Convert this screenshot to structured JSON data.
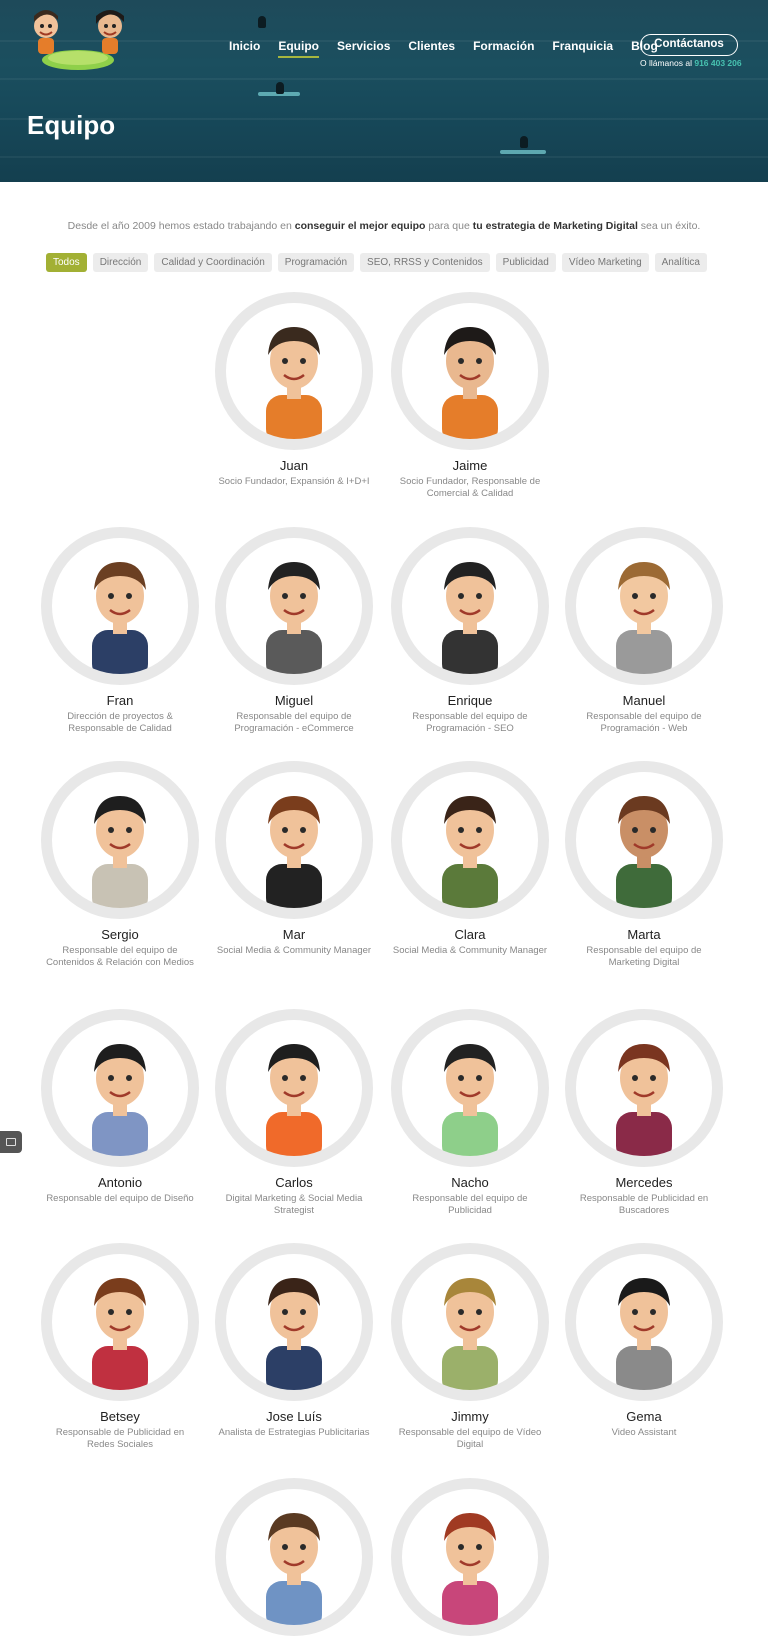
{
  "nav": {
    "items": [
      {
        "label": "Inicio",
        "active": false
      },
      {
        "label": "Equipo",
        "active": true
      },
      {
        "label": "Servicios",
        "active": false
      },
      {
        "label": "Clientes",
        "active": false
      },
      {
        "label": "Formación",
        "active": false
      },
      {
        "label": "Franquicia",
        "active": false
      },
      {
        "label": "Blog",
        "active": false
      }
    ],
    "contact_label": "Contáctanos",
    "call_text": "O llámanos al",
    "phone": "916 403 206"
  },
  "hero": {
    "title": "Equipo"
  },
  "intro": {
    "part1": "Desde el año 2009 hemos estado trabajando en ",
    "bold1": "conseguir el mejor equipo",
    "part2": " para que ",
    "bold2": "tu estrategia de Marketing Digital",
    "part3": " sea un éxito."
  },
  "filters": [
    {
      "label": "Todos",
      "active": true
    },
    {
      "label": "Dirección",
      "active": false
    },
    {
      "label": "Calidad y Coordinación",
      "active": false
    },
    {
      "label": "Programación",
      "active": false
    },
    {
      "label": "SEO, RRSS y Contenidos",
      "active": false
    },
    {
      "label": "Publicidad",
      "active": false
    },
    {
      "label": "Vídeo Marketing",
      "active": false
    },
    {
      "label": "Analítica",
      "active": false
    }
  ],
  "team": [
    {
      "name": "Juan",
      "role": "Socio Fundador, Expansión & I+D+I",
      "hair": "#3a2a1e",
      "shirt": "#e57d2a",
      "skin": "#f0c29a"
    },
    {
      "name": "Jaime",
      "role": "Socio Fundador, Responsable de Comercial & Calidad",
      "hair": "#1e1a18",
      "shirt": "#e57d2a",
      "skin": "#e9b88f"
    },
    {
      "name": "Fran",
      "role": "Dirección de proyectos & Responsable de Calidad",
      "hair": "#6b3f22",
      "shirt": "#2c3f66",
      "skin": "#f0c29a"
    },
    {
      "name": "Miguel",
      "role": "Responsable del equipo de Programación - eCommerce",
      "hair": "#222222",
      "shirt": "#5a5a5a",
      "skin": "#f0c29a"
    },
    {
      "name": "Enrique",
      "role": "Responsable del equipo de Programación - SEO",
      "hair": "#222222",
      "shirt": "#333333",
      "skin": "#f0c29a"
    },
    {
      "name": "Manuel",
      "role": "Responsable del equipo de Programación - Web",
      "hair": "#9c6a34",
      "shirt": "#9a9a9a",
      "skin": "#f2c8a0"
    },
    {
      "name": "Sergio",
      "role": "Responsable del equipo de Contenidos & Relación con Medios",
      "hair": "#1e1e1e",
      "shirt": "#c8c2b4",
      "skin": "#f0c29a"
    },
    {
      "name": "Mar",
      "role": "Social Media & Community Manager",
      "hair": "#7a3d1c",
      "shirt": "#222222",
      "skin": "#f0c29a"
    },
    {
      "name": "Clara",
      "role": "Social Media & Community Manager",
      "hair": "#3a2418",
      "shirt": "#5b7a3a",
      "skin": "#f0c29a"
    },
    {
      "name": "Marta",
      "role": "Responsable del equipo de Marketing Digital",
      "hair": "#6b3a20",
      "shirt": "#3f6b3a",
      "skin": "#c98f66"
    },
    {
      "name": "Antonio",
      "role": "Responsable del equipo de Diseño",
      "hair": "#1e1e1e",
      "shirt": "#7f95c4",
      "skin": "#f0c29a"
    },
    {
      "name": "Carlos",
      "role": "Digital Marketing & Social Media Strategist",
      "hair": "#1e1e1e",
      "shirt": "#f06a2a",
      "skin": "#f0c29a"
    },
    {
      "name": "Nacho",
      "role": "Responsable del equipo de Publicidad",
      "hair": "#222222",
      "shirt": "#8ecf8a",
      "skin": "#f0c29a"
    },
    {
      "name": "Mercedes",
      "role": "Responsable de Publicidad en Buscadores",
      "hair": "#7a3520",
      "shirt": "#8a2a48",
      "skin": "#f0c29a"
    },
    {
      "name": "Betsey",
      "role": "Responsable de Publicidad en Redes Sociales",
      "hair": "#7a3d1c",
      "shirt": "#c03040",
      "skin": "#f0c29a"
    },
    {
      "name": "Jose Luís",
      "role": "Analista de Estrategias Publicitarias",
      "hair": "#3a2418",
      "shirt": "#2c3f66",
      "skin": "#f0c29a"
    },
    {
      "name": "Jimmy",
      "role": "Responsable del equipo de Vídeo Digital",
      "hair": "#a8863a",
      "shirt": "#9bb06a",
      "skin": "#f0c29a"
    },
    {
      "name": "Gema",
      "role": "Video Assistant",
      "hair": "#1a1a1a",
      "shirt": "#8a8a8a",
      "skin": "#f0c29a"
    },
    {
      "name": "",
      "role": "",
      "hair": "#5a3a22",
      "shirt": "#6f93c4",
      "skin": "#f0c29a"
    },
    {
      "name": "",
      "role": "",
      "hair": "#a03a22",
      "shirt": "#c8467a",
      "skin": "#f0c29a"
    }
  ]
}
